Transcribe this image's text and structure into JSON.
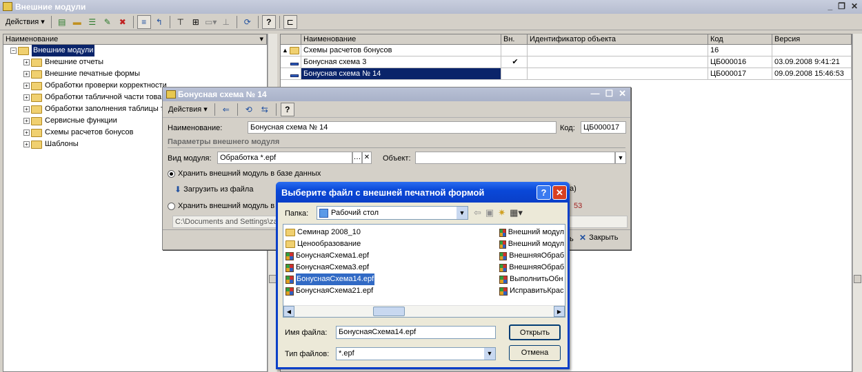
{
  "main": {
    "title": "Внешние модули",
    "actions_label": "Действия"
  },
  "tree": {
    "header": "Наименование",
    "root": "Внешние модули",
    "items": [
      "Внешние отчеты",
      "Внешние печатные формы",
      "Обработки проверки корректности",
      "Обработки табличной части товаров",
      "Обработки заполнения таблицы т",
      "Сервисные функции",
      "Схемы расчетов бонусов",
      "Шаблоны"
    ]
  },
  "grid": {
    "columns": [
      "Наименование",
      "Вн.",
      "Идентификатор объекта",
      "Код",
      "Версия"
    ],
    "rows": [
      {
        "name": "Схемы расчетов бонусов",
        "ext": "",
        "id": "",
        "code": "16",
        "version": ""
      },
      {
        "name": "Бонусная схема 3",
        "ext": "✔",
        "id": "",
        "code": "ЦБ000016",
        "version": "03.09.2008 9:41:21"
      },
      {
        "name": "Бонусная схема № 14",
        "ext": "",
        "id": "",
        "code": "ЦБ000017",
        "version": "09.09.2008 15:46:53"
      }
    ]
  },
  "form": {
    "title": "Бонусная схема № 14",
    "actions_label": "Действия",
    "name_label": "Наименование:",
    "name_value": "Бонусная схема № 14",
    "code_label": "Код:",
    "code_value": "ЦБ000017",
    "section_title": "Параметры внешнего модуля",
    "module_type_label": "Вид модуля:",
    "module_type_value": "Обработка *.epf",
    "object_label": "Объект:",
    "object_value": "",
    "radio_db": "Хранить внешний модуль в базе данных",
    "load_button": "Загрузить из файла",
    "radio_file": "Хранить внешний модуль в",
    "path_value": "C:\\Documents and Settings\\za",
    "partial_right_1": "a)",
    "partial_right_2": "53",
    "ok_partial": "ь",
    "close_button": "Закрыть"
  },
  "dialog": {
    "title": "Выберите файл с внешней печатной формой",
    "folder_label": "Папка:",
    "folder_value": "Рабочий стол",
    "files_left": [
      {
        "name": "Семинар 2008_10",
        "kind": "folder"
      },
      {
        "name": "Ценообразование",
        "kind": "folder"
      },
      {
        "name": "БонуснаяСхема1.epf",
        "kind": "file"
      },
      {
        "name": "БонуснаяСхема3.epf",
        "kind": "file"
      },
      {
        "name": "БонуснаяСхема14.epf",
        "kind": "file"
      },
      {
        "name": "БонуснаяСхема21.epf",
        "kind": "file"
      }
    ],
    "files_right": [
      {
        "name": "Внешний модул"
      },
      {
        "name": "Внешний модул"
      },
      {
        "name": "ВнешняяОбраб"
      },
      {
        "name": "ВнешняяОбраб"
      },
      {
        "name": "ВыполнитьОбн"
      },
      {
        "name": "ИсправитьКрас"
      }
    ],
    "filename_label": "Имя файла:",
    "filename_value": "БонуснаяСхема14.epf",
    "filetype_label": "Тип файлов:",
    "filetype_value": "*.epf",
    "open_button": "Открыть",
    "cancel_button": "Отмена"
  }
}
